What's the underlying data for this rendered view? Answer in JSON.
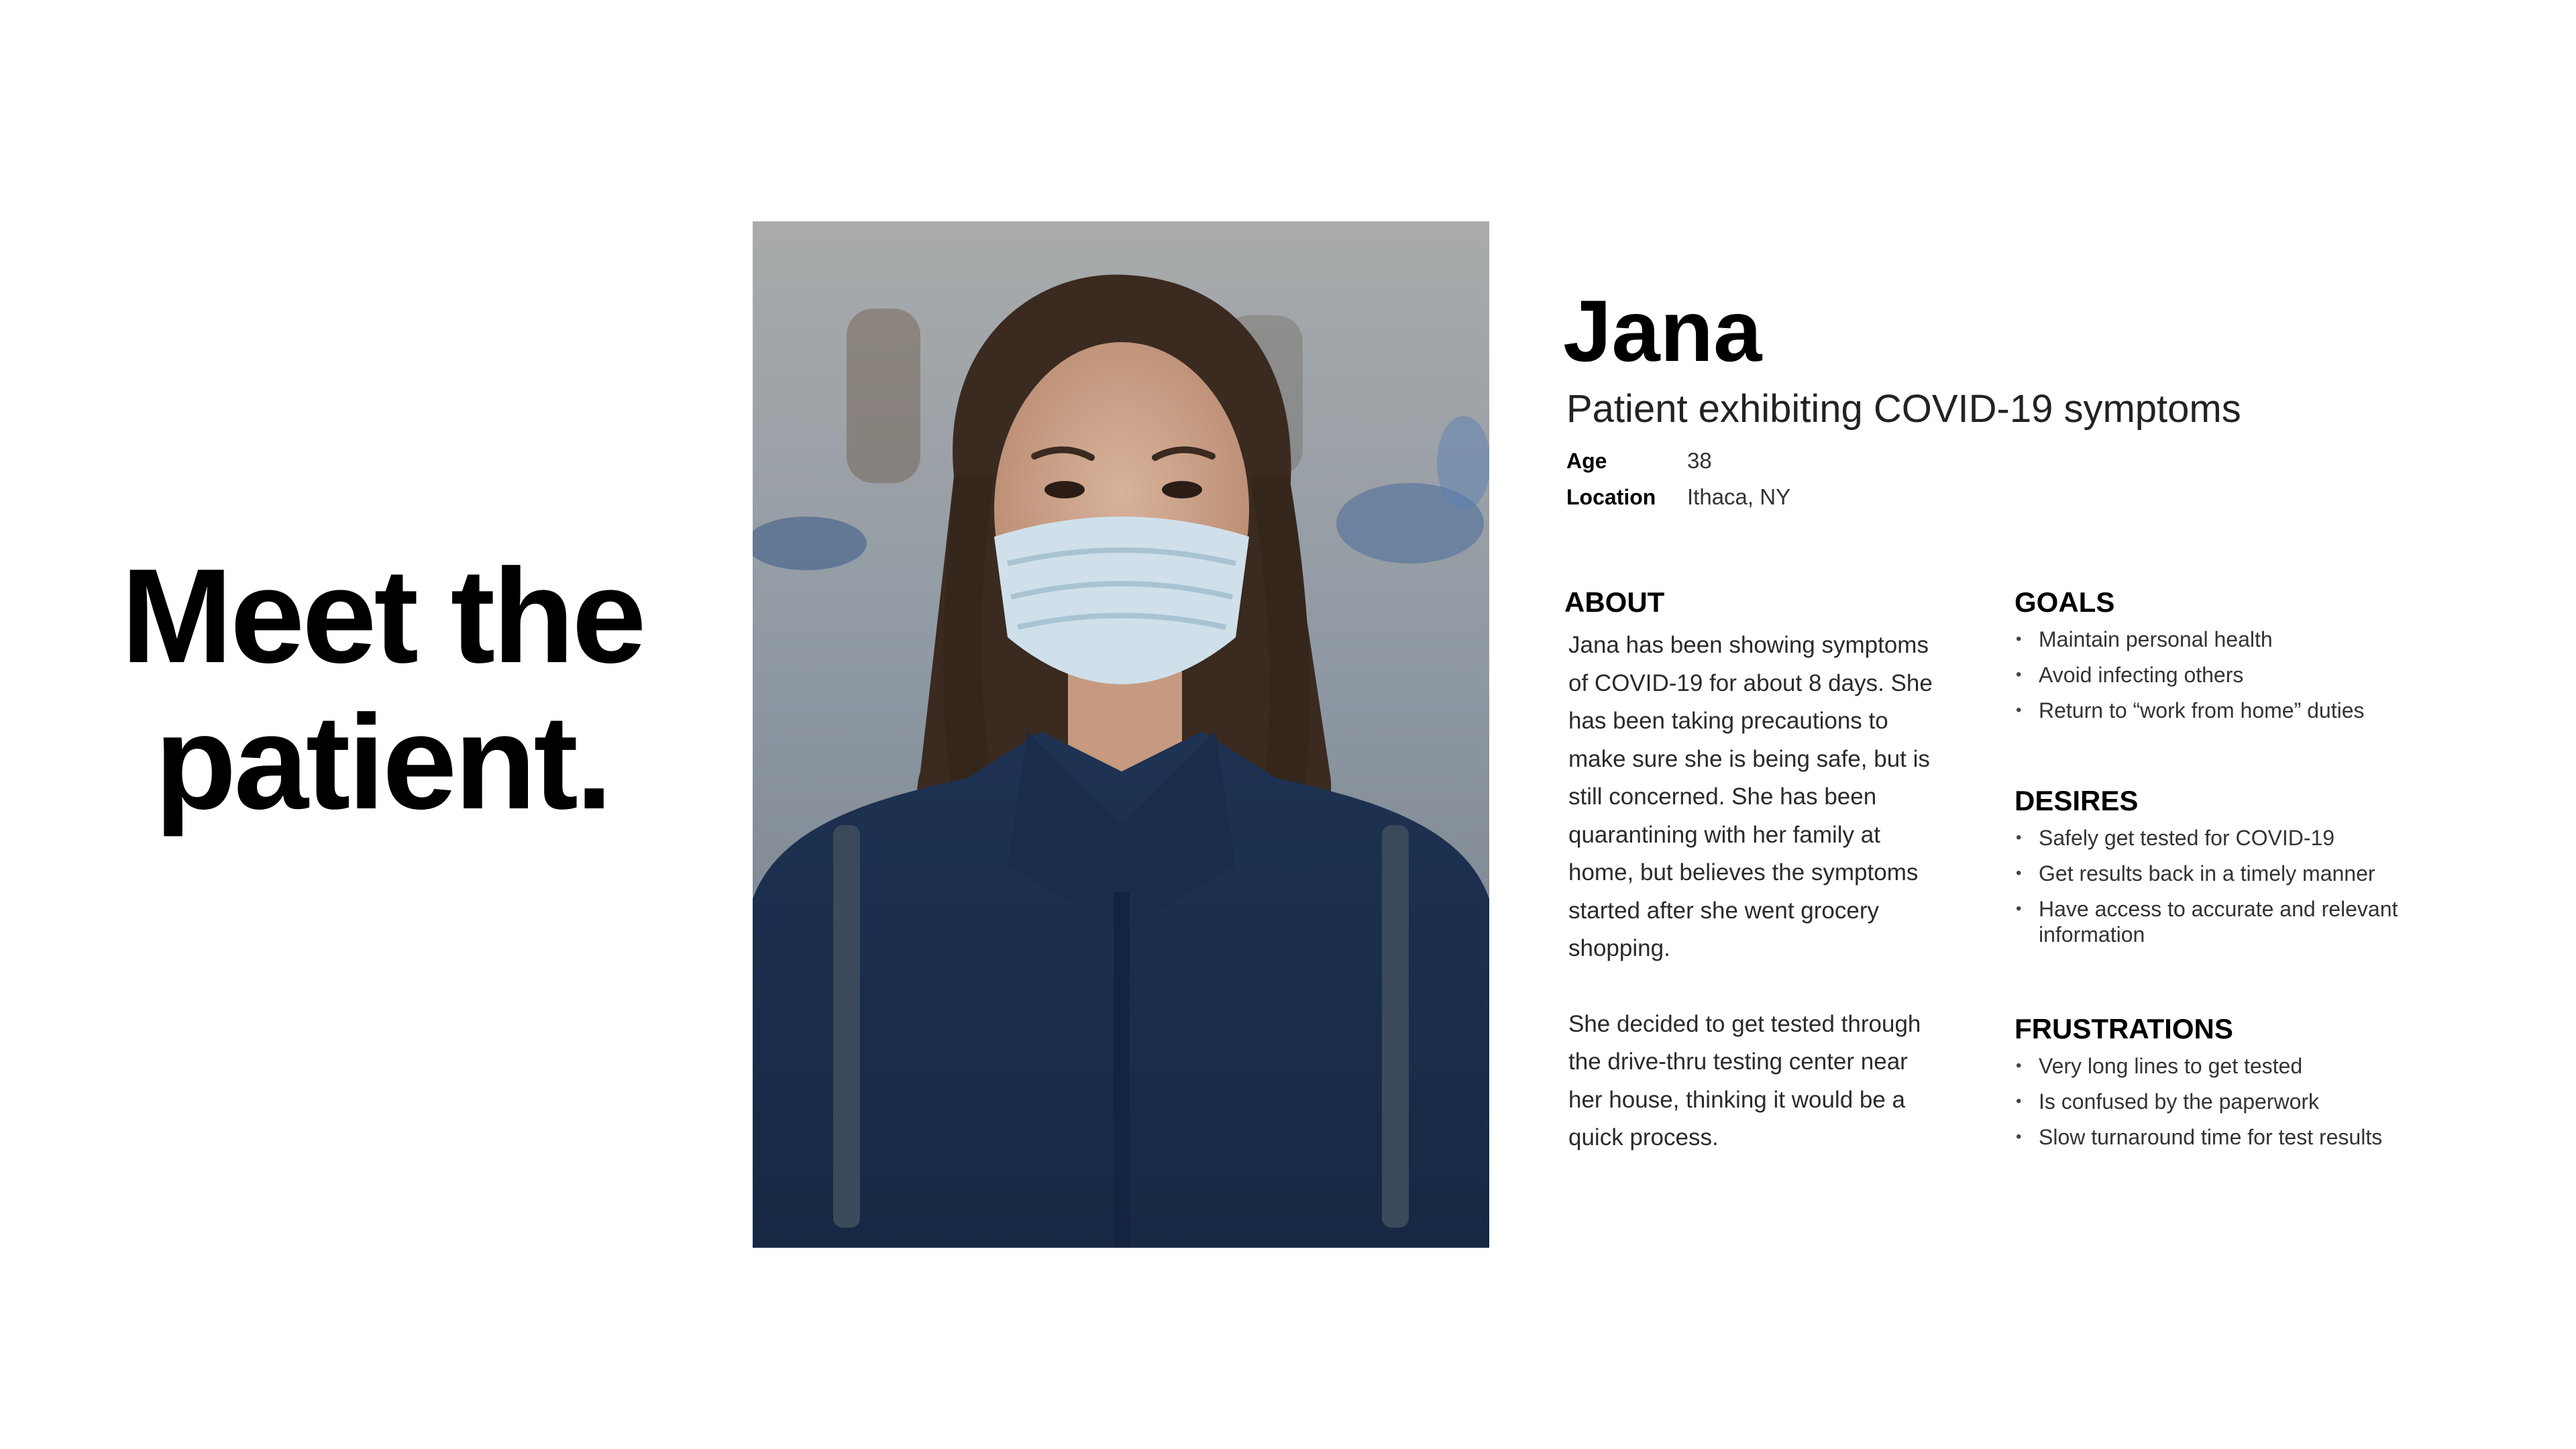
{
  "headline": {
    "line1": "Meet the",
    "line2": "patient."
  },
  "persona": {
    "name": "Jana",
    "subtitle": "Patient exhibiting COVID-19 symptoms",
    "age_label": "Age",
    "age_value": "38",
    "location_label": "Location",
    "location_value": "Ithaca, NY"
  },
  "about": {
    "title": "ABOUT",
    "paragraphs": [
      "Jana has been showing symptoms of COVID-19 for about 8 days. She has been taking precautions to make sure she is being safe, but is still concerned. She has been quarantining with her family at home, but believes the symptoms started after she went grocery shopping.",
      "She decided to get tested through the drive-thru testing center near her house, thinking it would be a quick process."
    ]
  },
  "goals": {
    "title": "GOALS",
    "items": [
      "Maintain personal health",
      "Avoid infecting others",
      "Return to “work from home” duties"
    ]
  },
  "desires": {
    "title": "DESIRES",
    "items": [
      "Safely get tested for COVID-19",
      "Get results back in a timely manner",
      "Have access to accurate and relevant information"
    ]
  },
  "frustrations": {
    "title": "FRUSTRATIONS",
    "items": [
      "Very long lines to get tested",
      "Is confused by the paperwork",
      "Slow turnaround time for test results"
    ]
  },
  "colors": {
    "background": "#ffffff",
    "text": "#111111",
    "coat": "#1f3556",
    "mask": "#cfe0ea",
    "hair": "#3a2a20"
  }
}
